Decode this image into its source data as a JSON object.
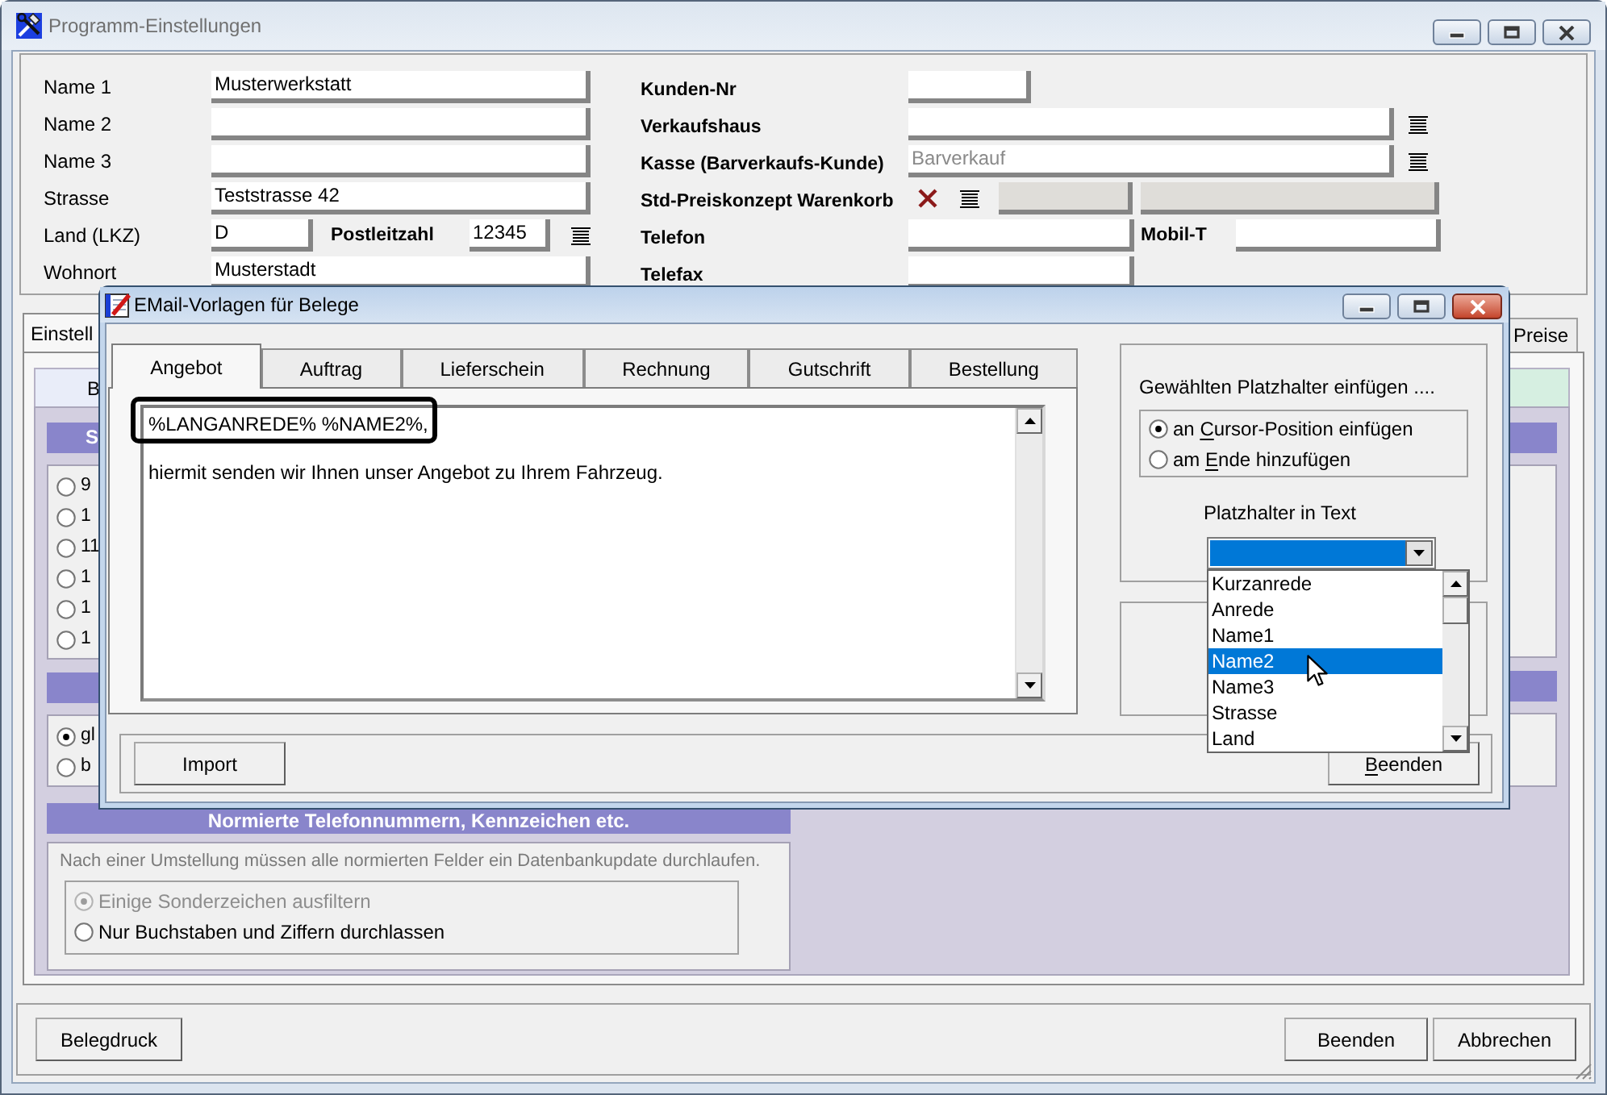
{
  "main_window": {
    "title": "Programm-Einstellungen",
    "active": false
  },
  "address_form": {
    "left_rows": [
      {
        "kind": "text",
        "label": "Name 1",
        "value": "Musterwerkstatt"
      },
      {
        "kind": "text",
        "label": "Name 2"
      },
      {
        "kind": "text",
        "label": "Name 3"
      },
      {
        "kind": "text",
        "label": "Strasse",
        "value": "Teststrasse 42"
      },
      {
        "kind": "country_zip",
        "label": "Land (LKZ)",
        "value": "D",
        "zip_label": "Postleitzahl",
        "zip_value": "12345"
      },
      {
        "kind": "text",
        "label": "Wohnort",
        "value": "Musterstadt"
      }
    ],
    "right_rows": [
      {
        "kind": "short",
        "label": "Kunden-Nr"
      },
      {
        "kind": "lookup",
        "label": "Verkaufshaus"
      },
      {
        "kind": "lookup",
        "label": "Kasse (Barverkaufs-Kunde)",
        "placeholder": "Barverkauf"
      },
      {
        "kind": "price_concept",
        "label": "Std-Preiskonzept Warenkorb"
      },
      {
        "kind": "phone",
        "label": "Telefon",
        "mobile_label": "Mobil-T"
      },
      {
        "kind": "medium",
        "label": "Telefax"
      }
    ]
  },
  "settings_tabs": [
    {
      "label": "Einstell",
      "selected": true
    },
    {
      "label": "Preise",
      "selected": false
    }
  ],
  "sub_tabs": [
    {
      "label": "B",
      "color": "#e9edf9"
    },
    {
      "color": "#d6efe1"
    }
  ],
  "left_sections": [
    {
      "kind": "radio_list",
      "title": "S",
      "options": [
        {
          "label": "9",
          "selected": false
        },
        {
          "label": "1",
          "selected": false
        },
        {
          "label": "11",
          "selected": false
        },
        {
          "label": "1",
          "selected": false
        },
        {
          "label": "1",
          "selected": false
        },
        {
          "label": "1",
          "selected": false
        }
      ]
    },
    {
      "kind": "radio_list",
      "options": [
        {
          "label": "gl",
          "selected": true
        },
        {
          "label": "b",
          "selected": false
        }
      ]
    },
    {
      "kind": "note_radio",
      "title": "Normierte Telefonnummern, Kennzeichen etc.",
      "note": "Nach einer Umstellung müssen alle normierten Felder ein Datenbankupdate durchlaufen.",
      "options": [
        {
          "label": "Einige Sonderzeichen ausfiltern",
          "selected": true,
          "disabled": true
        },
        {
          "label": "Nur Buchstaben und Ziffern durchlassen",
          "selected": false,
          "disabled": false
        }
      ]
    }
  ],
  "footer": {
    "left_buttons": [
      "Belegdruck"
    ],
    "right_buttons": [
      "Beenden",
      "Abbrechen"
    ]
  },
  "dialog": {
    "title": "EMail-Vorlagen für Belege",
    "active": true,
    "tabs": [
      {
        "label": "Angebot",
        "selected": true
      },
      {
        "label": "Auftrag",
        "selected": false
      },
      {
        "label": "Lieferschein",
        "selected": false
      },
      {
        "label": "Rechnung",
        "selected": false
      },
      {
        "label": "Gutschrift",
        "selected": false
      },
      {
        "label": "Bestellung",
        "selected": false
      }
    ],
    "template_lines": [
      {
        "text": "%LANGANREDE% %NAME2%,",
        "highlighted": true
      },
      {
        "text": "hiermit senden wir Ihnen unser Angebot zu Ihrem Fahrzeug.",
        "highlighted": false
      }
    ],
    "insert_group": {
      "title": "Gewählten Platzhalter einfügen ....",
      "options": [
        {
          "parts": [
            {
              "text": "an ",
              "underline": false
            },
            {
              "text": "C",
              "underline": true
            },
            {
              "text": "ursor-Position einfügen",
              "underline": false
            }
          ],
          "selected": true
        },
        {
          "parts": [
            {
              "text": "am ",
              "underline": false
            },
            {
              "text": "E",
              "underline": true
            },
            {
              "text": "nde hinzufügen",
              "underline": false
            }
          ],
          "selected": false
        }
      ]
    },
    "placeholder_select": {
      "label": "Platzhalter in Text",
      "expanded": true,
      "items": [
        {
          "label": "Kurzanrede",
          "selected": false
        },
        {
          "label": "Anrede",
          "selected": false
        },
        {
          "label": "Name1",
          "selected": false
        },
        {
          "label": "Name2",
          "selected": true
        },
        {
          "label": "Name3",
          "selected": false
        },
        {
          "label": "Strasse",
          "selected": false
        },
        {
          "label": "Land",
          "selected": false
        }
      ]
    },
    "buttons": [
      {
        "kind": "left",
        "parts": [
          {
            "text": "Import",
            "underline": false
          }
        ]
      },
      {
        "kind": "right",
        "parts": [
          {
            "text": "B",
            "underline": true
          },
          {
            "text": "eenden",
            "underline": false
          }
        ]
      }
    ]
  }
}
